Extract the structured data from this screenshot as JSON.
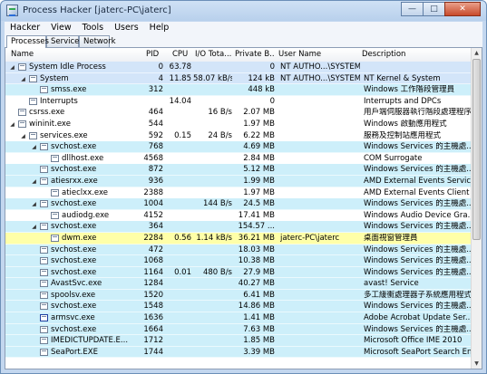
{
  "window": {
    "title": "Process Hacker [jaterc-PC\\jaterc]"
  },
  "menu": [
    "Hacker",
    "View",
    "Tools",
    "Users",
    "Help"
  ],
  "tabs": [
    "Processes",
    "Services",
    "Network"
  ],
  "columns": [
    "Name",
    "PID",
    "CPU",
    "I/O Tota...",
    "Private B...",
    "User Name",
    "Description"
  ],
  "colors": {
    "light_blue": "#cdeffa",
    "yellow": "#ffffa8",
    "selection": "#d3e5f9",
    "pink": "#f8dfe8"
  },
  "icons": {
    "expand": "expand-icon",
    "collapse": "collapse-icon",
    "process": "process-icon"
  },
  "processes": [
    {
      "name": "System Idle Process",
      "pid": "0",
      "cpu": "63.78",
      "io": "",
      "priv": "0",
      "user": "NT AUTHO...\\SYSTEM",
      "desc": "",
      "indent": 0,
      "exp": "minus",
      "bg": "#d3e5f9"
    },
    {
      "name": "System",
      "pid": "4",
      "cpu": "11.85",
      "io": "58.07 kB/s",
      "priv": "124 kB",
      "user": "NT AUTHO...\\SYSTEM",
      "desc": "NT Kernel & System",
      "indent": 1,
      "exp": "minus",
      "bg": "#d3e5f9"
    },
    {
      "name": "smss.exe",
      "pid": "312",
      "cpu": "",
      "io": "",
      "priv": "448 kB",
      "user": "",
      "desc": "Windows 工作階段管理員",
      "indent": 2,
      "exp": "",
      "bg": "#cdeffa"
    },
    {
      "name": "Interrupts",
      "pid": "",
      "cpu": "14.04",
      "io": "",
      "priv": "0",
      "user": "",
      "desc": "Interrupts and DPCs",
      "indent": 1,
      "exp": "",
      "bg": "#ffffff"
    },
    {
      "name": "csrss.exe",
      "pid": "464",
      "cpu": "",
      "io": "16 B/s",
      "priv": "2.07 MB",
      "user": "",
      "desc": "用戶端伺服器執行階段處理程序",
      "indent": 0,
      "exp": "",
      "bg": "#ffffff"
    },
    {
      "name": "wininit.exe",
      "pid": "544",
      "cpu": "",
      "io": "",
      "priv": "1.97 MB",
      "user": "",
      "desc": "Windows 啟動應用程式",
      "indent": 0,
      "exp": "minus",
      "bg": "#ffffff"
    },
    {
      "name": "services.exe",
      "pid": "592",
      "cpu": "0.15",
      "io": "24 B/s",
      "priv": "6.22 MB",
      "user": "",
      "desc": "服務及控制站應用程式",
      "indent": 1,
      "exp": "minus",
      "bg": "#ffffff"
    },
    {
      "name": "svchost.exe",
      "pid": "768",
      "cpu": "",
      "io": "",
      "priv": "4.69 MB",
      "user": "",
      "desc": "Windows Services 的主機處...",
      "indent": 2,
      "exp": "minus",
      "bg": "#cdeffa"
    },
    {
      "name": "dllhost.exe",
      "pid": "4568",
      "cpu": "",
      "io": "",
      "priv": "2.84 MB",
      "user": "",
      "desc": "COM Surrogate",
      "indent": 3,
      "exp": "",
      "bg": "#ffffff"
    },
    {
      "name": "svchost.exe",
      "pid": "872",
      "cpu": "",
      "io": "",
      "priv": "5.12 MB",
      "user": "",
      "desc": "Windows Services 的主機處...",
      "indent": 2,
      "exp": "",
      "bg": "#cdeffa"
    },
    {
      "name": "atiesrxx.exe",
      "pid": "936",
      "cpu": "",
      "io": "",
      "priv": "1.99 MB",
      "user": "",
      "desc": "AMD External Events Service...",
      "indent": 2,
      "exp": "minus",
      "bg": "#cdeffa"
    },
    {
      "name": "atieclxx.exe",
      "pid": "2388",
      "cpu": "",
      "io": "",
      "priv": "1.97 MB",
      "user": "",
      "desc": "AMD External Events Client ...",
      "indent": 3,
      "exp": "",
      "bg": "#ffffff"
    },
    {
      "name": "svchost.exe",
      "pid": "1004",
      "cpu": "",
      "io": "144 B/s",
      "priv": "24.5 MB",
      "user": "",
      "desc": "Windows Services 的主機處...",
      "indent": 2,
      "exp": "minus",
      "bg": "#cdeffa"
    },
    {
      "name": "audiodg.exe",
      "pid": "4152",
      "cpu": "",
      "io": "",
      "priv": "17.41 MB",
      "user": "",
      "desc": "Windows Audio Device Gra...",
      "indent": 3,
      "exp": "",
      "bg": "#ffffff"
    },
    {
      "name": "svchost.exe",
      "pid": "364",
      "cpu": "",
      "io": "",
      "priv": "154.57 ...",
      "user": "",
      "desc": "Windows Services 的主機處...",
      "indent": 2,
      "exp": "minus",
      "bg": "#cdeffa"
    },
    {
      "name": "dwm.exe",
      "pid": "2284",
      "cpu": "0.56",
      "io": "1.14 kB/s",
      "priv": "36.21 MB",
      "user": "jaterc-PC\\jaterc",
      "desc": "桌面視窗管理員",
      "indent": 3,
      "exp": "",
      "bg": "#ffffa8"
    },
    {
      "name": "svchost.exe",
      "pid": "472",
      "cpu": "",
      "io": "",
      "priv": "18.03 MB",
      "user": "",
      "desc": "Windows Services 的主機處...",
      "indent": 2,
      "exp": "",
      "bg": "#cdeffa"
    },
    {
      "name": "svchost.exe",
      "pid": "1068",
      "cpu": "",
      "io": "",
      "priv": "10.38 MB",
      "user": "",
      "desc": "Windows Services 的主機處...",
      "indent": 2,
      "exp": "",
      "bg": "#cdeffa"
    },
    {
      "name": "svchost.exe",
      "pid": "1164",
      "cpu": "0.01",
      "io": "480 B/s",
      "priv": "27.9 MB",
      "user": "",
      "desc": "Windows Services 的主機處...",
      "indent": 2,
      "exp": "",
      "bg": "#cdeffa"
    },
    {
      "name": "AvastSvc.exe",
      "pid": "1284",
      "cpu": "",
      "io": "",
      "priv": "40.27 MB",
      "user": "",
      "desc": "avast! Service",
      "indent": 2,
      "exp": "",
      "bg": "#cdeffa"
    },
    {
      "name": "spoolsv.exe",
      "pid": "1520",
      "cpu": "",
      "io": "",
      "priv": "6.41 MB",
      "user": "",
      "desc": "多工緩衝處理器子系統應用程式",
      "indent": 2,
      "exp": "",
      "bg": "#cdeffa"
    },
    {
      "name": "svchost.exe",
      "pid": "1548",
      "cpu": "",
      "io": "",
      "priv": "14.86 MB",
      "user": "",
      "desc": "Windows Services 的主機處...",
      "indent": 2,
      "exp": "",
      "bg": "#cdeffa"
    },
    {
      "name": "armsvc.exe",
      "pid": "1636",
      "cpu": "",
      "io": "",
      "priv": "1.41 MB",
      "user": "",
      "desc": "Adobe Acrobat Update Ser...",
      "indent": 2,
      "exp": "",
      "bg": "#cdeffa",
      "icon_style": "blueframe"
    },
    {
      "name": "svchost.exe",
      "pid": "1664",
      "cpu": "",
      "io": "",
      "priv": "7.63 MB",
      "user": "",
      "desc": "Windows Services 的主機處...",
      "indent": 2,
      "exp": "",
      "bg": "#cdeffa"
    },
    {
      "name": "IMEDICTUPDATE.E...",
      "pid": "1712",
      "cpu": "",
      "io": "",
      "priv": "1.85 MB",
      "user": "",
      "desc": "Microsoft Office IME 2010",
      "indent": 2,
      "exp": "",
      "bg": "#cdeffa"
    },
    {
      "name": "SeaPort.EXE",
      "pid": "1744",
      "cpu": "",
      "io": "",
      "priv": "3.39 MB",
      "user": "",
      "desc": "Microsoft SeaPort Search En...",
      "indent": 2,
      "exp": "",
      "bg": "#cdeffa"
    }
  ]
}
